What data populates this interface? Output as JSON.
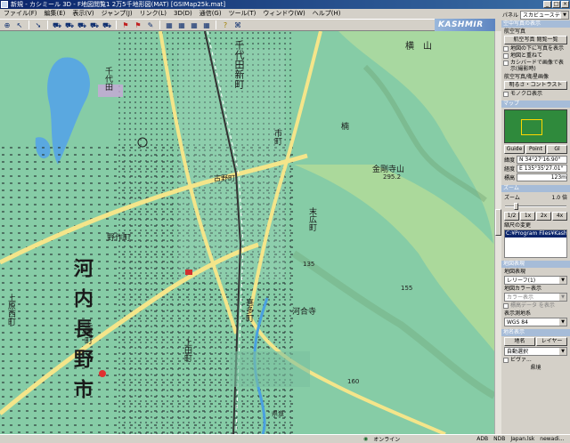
{
  "window": {
    "title": "新規 - カシミール 3D - F地図閲覧1 2万5千地形図(MAT) [GSIMap25k.mat]",
    "min": "_",
    "max": "□",
    "close": "×"
  },
  "menu": [
    "ファイル(F)",
    "編集(E)",
    "表示(V)",
    "ジャンプ(J)",
    "リンク(L)",
    "3D(D)",
    "通信(G)",
    "ツール(T)",
    "ウィンドウ(W)",
    "ヘルプ(H)"
  ],
  "toolbar_icons": [
    "zoom-icon",
    "pointer-icon",
    "back-icon",
    "car-icon",
    "car-icon",
    "car-icon",
    "car-icon",
    "car-icon",
    "marker-icon",
    "marker-icon",
    "pencil-icon",
    "grid-icon",
    "grid-icon",
    "grid-icon",
    "grid-icon",
    "help-icon",
    "info-icon"
  ],
  "brand": "KASHMIR 3D",
  "map": {
    "labels": [
      {
        "text": "横",
        "size": 10
      },
      {
        "text": "山",
        "size": 10
      },
      {
        "text": "千代田新町",
        "size": 11
      },
      {
        "text": "千代田",
        "size": 9
      },
      {
        "text": "楠",
        "size": 9
      },
      {
        "text": "市町",
        "size": 9
      },
      {
        "text": "古野町",
        "size": 8
      },
      {
        "text": "金剛寺山",
        "size": 9
      },
      {
        "text": "末広町",
        "size": 9
      },
      {
        "text": "野作町",
        "size": 9
      },
      {
        "text": "河内長野市",
        "size": 22
      },
      {
        "text": "上原西町",
        "size": 9
      },
      {
        "text": "上原町",
        "size": 9
      },
      {
        "text": "河合寺",
        "size": 9
      },
      {
        "text": "喜多町",
        "size": 9
      },
      {
        "text": "上田町",
        "size": 9
      },
      {
        "text": "県道",
        "size": 7
      }
    ],
    "elevations": [
      "295.2",
      "135",
      "155",
      "160"
    ]
  },
  "panel": {
    "panel_label": "パネル",
    "panel_select": "スカビューステア",
    "air_header": "空中写真の表示",
    "air_photo_label": "航空写真",
    "air_photo_button": "航空写真 閲覧一覧",
    "cb1": "地図の下に写真を表示",
    "cb2": "地図と重ねて",
    "cb3": "カシバードで画像で表示(撮影時)",
    "air_settings_label": "航空写真/衛星画像",
    "brightness_button": "明るさ・コントラスト",
    "mono_label": "モノクロ表示",
    "map_header": "マップ",
    "minimap_tabs": [
      "Guide",
      "Point",
      "Gl"
    ],
    "lat_label": "緯度",
    "lat_value": "N 34°27'16.90\"",
    "lon_label": "経度",
    "lon_value": "E 135°35'27.01\"",
    "alt_label": "標高",
    "alt_value": "123m",
    "zoom_header": "ズーム",
    "zoom_label": "ズーム",
    "zoom_value": "1.0 倍",
    "zoom_buttons": [
      "1/2",
      "1x",
      "2x",
      "4x"
    ],
    "path_label": "縮尺の変更",
    "path_value": "C:¥Program Files¥Kashmir",
    "view_header": "地図表現",
    "style_label": "地図表現",
    "style_value": "レリーフ(1)",
    "color_label": "地図カラー表示",
    "color_value": "カラー表示",
    "elev_label": "標高データ を表示",
    "datum_label": "表示測地系",
    "datum_value": "WGS 84",
    "tab_header": "地名表示",
    "tab_a": "地名",
    "tab_b": "レイヤー",
    "auto_select": "自動選択",
    "checkbox_last": "ビヴァ...",
    "bottom_label": "県境"
  },
  "status": {
    "online": "オンライン",
    "items": [
      "ADB",
      "NDB",
      "Japan.lsk",
      "newadi..."
    ]
  }
}
